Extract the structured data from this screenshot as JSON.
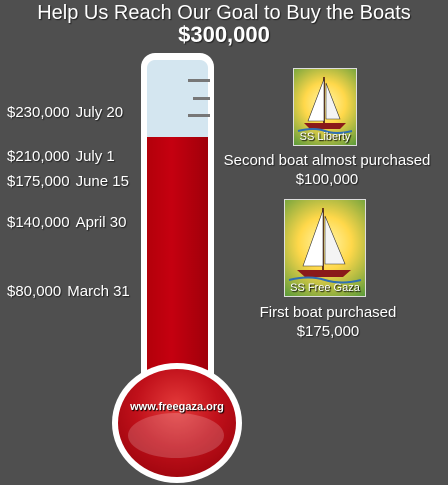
{
  "header": {
    "title": "Help Us Reach Our Goal to Buy the Boats",
    "goal": "$300,000"
  },
  "milestones": [
    {
      "amount": "$230,000",
      "date": "July 20"
    },
    {
      "amount": "$210,000",
      "date": "July 1"
    },
    {
      "amount": "$175,000",
      "date": "June 15"
    },
    {
      "amount": "$140,000",
      "date": "April 30"
    },
    {
      "amount": "$80,000",
      "date": "March 31"
    }
  ],
  "thermometer": {
    "fill_fraction": 0.767,
    "website": "www.freegaza.org"
  },
  "boats": [
    {
      "name": "SS Liberty",
      "status": "Second boat almost purchased",
      "amount": "$100,000"
    },
    {
      "name": "SS Free Gaza",
      "status": "First boat purchased",
      "amount": "$175,000"
    }
  ],
  "colors": {
    "background": "#4f4f4f",
    "mercury": "#c50010",
    "tube": "#d4e6f0"
  }
}
